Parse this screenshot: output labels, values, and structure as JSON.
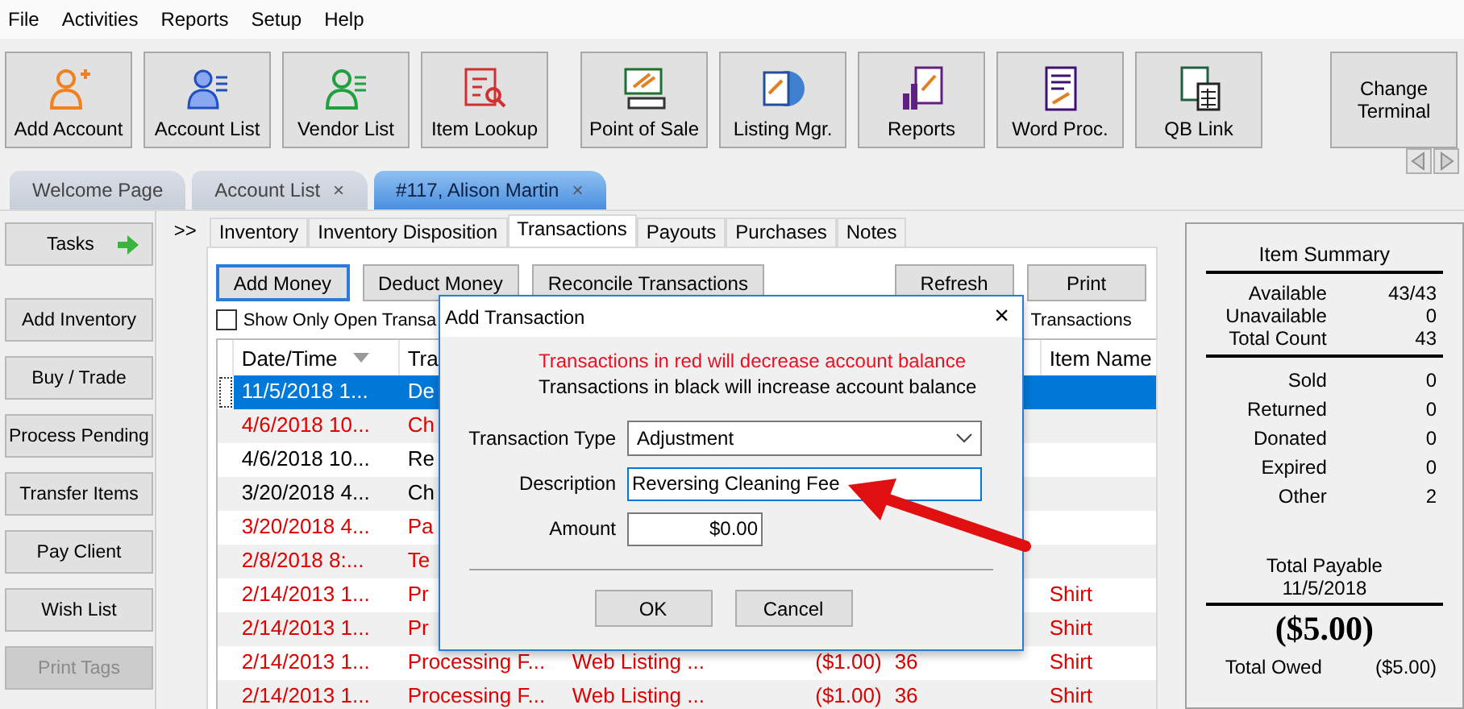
{
  "menu": [
    "File",
    "Activities",
    "Reports",
    "Setup",
    "Help"
  ],
  "toolbar": [
    {
      "label": "Add Account"
    },
    {
      "label": "Account List"
    },
    {
      "label": "Vendor List"
    },
    {
      "label": "Item Lookup"
    },
    {
      "label": "Point of Sale"
    },
    {
      "label": "Listing Mgr."
    },
    {
      "label": "Reports"
    },
    {
      "label": "Word Proc."
    },
    {
      "label": "QB Link"
    }
  ],
  "change_terminal": "Change Terminal",
  "tabs": [
    {
      "label": "Welcome Page",
      "selected": false
    },
    {
      "label": "Account List",
      "close": "×",
      "selected": false
    },
    {
      "label": "#117, Alison Martin",
      "close": "×",
      "selected": true
    }
  ],
  "sidebar": [
    {
      "label": "Tasks",
      "kind": "header",
      "disabled": false
    },
    {
      "label": "Add Inventory",
      "kind": "task",
      "disabled": false
    },
    {
      "label": "Buy / Trade",
      "kind": "task",
      "disabled": false
    },
    {
      "label": "Process Pending",
      "kind": "task",
      "disabled": false
    },
    {
      "label": "Transfer Items",
      "kind": "task",
      "disabled": false
    },
    {
      "label": "Pay Client",
      "kind": "task",
      "disabled": false
    },
    {
      "label": "Wish List",
      "kind": "task",
      "disabled": false
    },
    {
      "label": "Print Tags",
      "kind": "task",
      "disabled": true
    }
  ],
  "expander": ">>",
  "subtabs": [
    {
      "label": "Inventory",
      "selected": false
    },
    {
      "label": "Inventory Disposition",
      "selected": false
    },
    {
      "label": "Transactions",
      "selected": true
    },
    {
      "label": "Payouts",
      "selected": false
    },
    {
      "label": "Purchases",
      "selected": false
    },
    {
      "label": "Notes",
      "selected": false
    }
  ],
  "actions": [
    {
      "label": "Add Money",
      "focused": true
    },
    {
      "label": "Deduct Money",
      "focused": false
    },
    {
      "label": "Reconcile Transactions",
      "focused": false
    }
  ],
  "right_actions": [
    "Refresh",
    "Print"
  ],
  "filter": {
    "label": "Show Only Open Transa",
    "checked": false
  },
  "filter_tail": "Transactions",
  "columns": {
    "date": {
      "label": "Date/Time",
      "sorted": true
    },
    "type": "Tra",
    "item_name": "Item Name"
  },
  "rows": [
    {
      "date": "11/5/2018 1...",
      "type": "De",
      "selected": true
    },
    {
      "date": "4/6/2018 10...",
      "type": "Ch",
      "selected": false,
      "decrease": true
    },
    {
      "date": "4/6/2018 10...",
      "type": "Re",
      "selected": false,
      "decrease": false
    },
    {
      "date": "3/20/2018 4...",
      "type": "Ch",
      "selected": false,
      "decrease": false
    },
    {
      "date": "3/20/2018 4...",
      "type": "Pa",
      "selected": false,
      "decrease": true
    },
    {
      "date": "2/8/2018 8:...",
      "type": "Te",
      "selected": false,
      "decrease": true
    },
    {
      "date": "2/14/2013 1...",
      "type": "Pr",
      "item_name": "Shirt",
      "selected": false,
      "decrease": true
    },
    {
      "date": "2/14/2013 1...",
      "type": "Pr",
      "item_name": "Shirt",
      "selected": false,
      "decrease": true
    },
    {
      "date": "2/14/2013 1...",
      "type": "Processing F...",
      "column_3": "Web Listing ...",
      "amount": "($1.00)",
      "column_5": "36",
      "item_name": "Shirt",
      "selected": false,
      "decrease": true
    },
    {
      "date": "2/14/2013 1...",
      "type": "Processing F...",
      "column_3": "Web Listing ...",
      "amount": "($1.00)",
      "column_5": "36",
      "item_name": "Shirt",
      "selected": false,
      "decrease": true
    }
  ],
  "summary": {
    "title": "Item Summary",
    "counts": [
      {
        "label": "Available",
        "value": "43/43"
      },
      {
        "label": "Unavailable",
        "value": "0"
      },
      {
        "label": "Total Count",
        "value": "43"
      }
    ],
    "dispositions": [
      {
        "label": "Sold",
        "value": "0"
      },
      {
        "label": "Returned",
        "value": "0"
      },
      {
        "label": "Donated",
        "value": "0"
      },
      {
        "label": "Expired",
        "value": "0"
      },
      {
        "label": "Other",
        "value": "2"
      }
    ],
    "payable_label": "Total Payable",
    "payable_date": "11/5/2018",
    "payable_amount": "($5.00)",
    "owed_label": "Total Owed",
    "owed_value": "($5.00)"
  },
  "dialog": {
    "title": "Add Transaction",
    "close": "×",
    "note_red": "Transactions in red will decrease account balance",
    "note_black": "Transactions in black will increase account balance",
    "type_label": "Transaction Type",
    "type_value": "Adjustment",
    "description_label": "Description",
    "description_value": "Reversing Cleaning Fee",
    "amount_label": "Amount",
    "amount_value": "$0.00",
    "buttons": [
      "OK",
      "Cancel"
    ]
  }
}
